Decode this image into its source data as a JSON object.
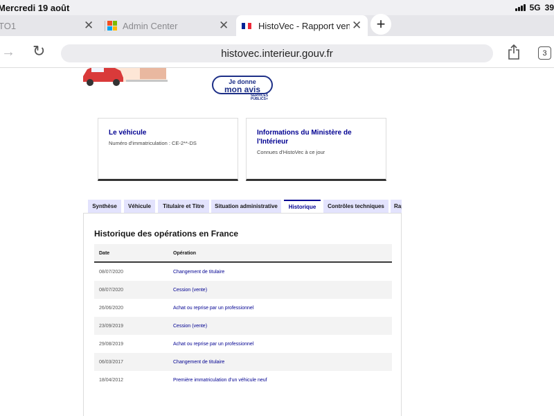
{
  "status_bar": {
    "date": "Mercredi 19 août",
    "network": "5G",
    "battery": "39"
  },
  "tabs": [
    {
      "title": "TO1",
      "active": false
    },
    {
      "title": "Admin Center",
      "active": false
    },
    {
      "title": "HistoVec - Rapport vendeur",
      "active": true
    }
  ],
  "toolbar": {
    "url": "histovec.interieur.gouv.fr",
    "tab_count": "3"
  },
  "banner": {
    "avis_line1": "Je donne",
    "avis_line2": "mon avis",
    "services_publics": "SERVICES PUBLICS+"
  },
  "cards": {
    "vehicle": {
      "title": "Le véhicule",
      "subtitle": "Numéro d'immatriculation : CE-2**-DS"
    },
    "ministry": {
      "title": "Informations du Ministère de l'Intérieur",
      "subtitle": "Connues d'HistoVec à ce jour"
    }
  },
  "section_tabs": [
    "Synthèse",
    "Véhicule",
    "Titulaire et Titre",
    "Situation administrative",
    "Historique",
    "Contrôles techniques",
    "Rapport"
  ],
  "history": {
    "title": "Historique des opérations en France",
    "columns": {
      "date": "Date",
      "operation": "Opération"
    },
    "rows": [
      {
        "date": "08/07/2020",
        "operation": "Changement de titulaire"
      },
      {
        "date": "08/07/2020",
        "operation": "Cession (vente)"
      },
      {
        "date": "26/06/2020",
        "operation": "Achat ou reprise par un professionnel"
      },
      {
        "date": "23/09/2019",
        "operation": "Cession (vente)"
      },
      {
        "date": "29/08/2019",
        "operation": "Achat ou reprise par un professionnel"
      },
      {
        "date": "06/03/2017",
        "operation": "Changement de titulaire"
      },
      {
        "date": "18/04/2012",
        "operation": "Première immatriculation d'un véhicule neuf"
      }
    ]
  }
}
